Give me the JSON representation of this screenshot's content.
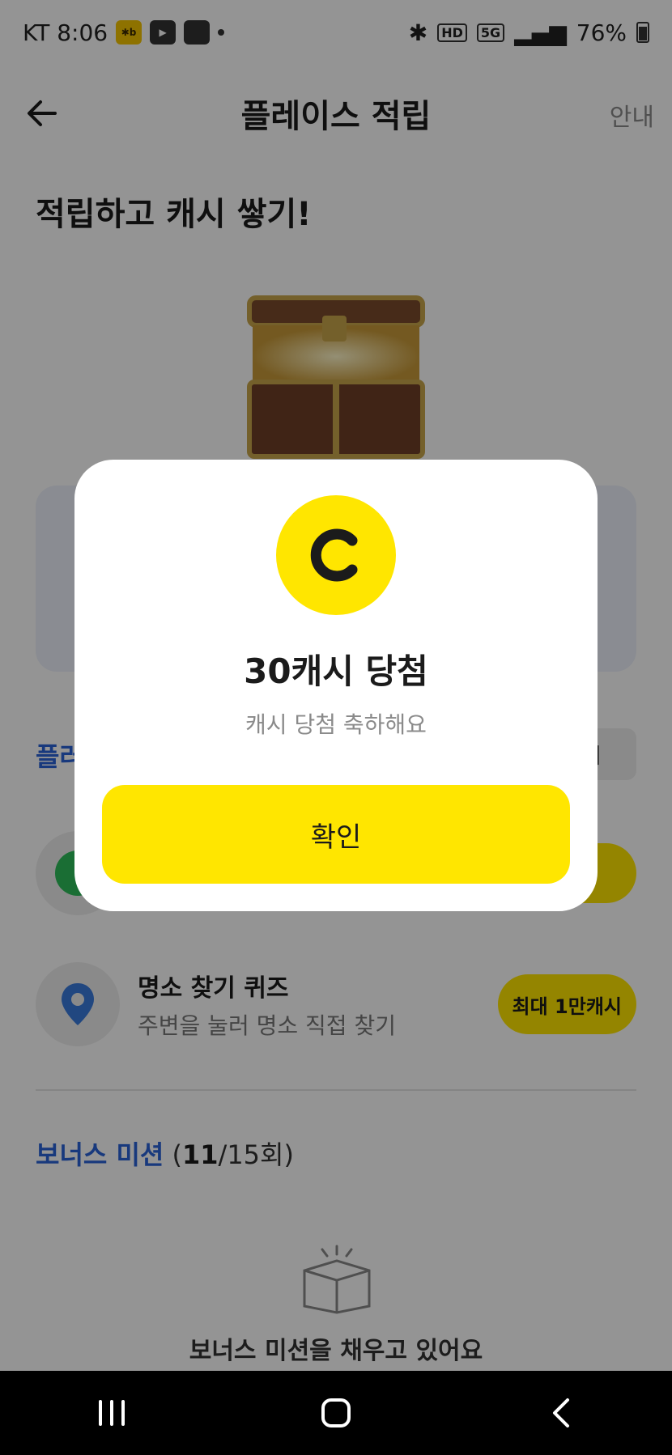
{
  "status_bar": {
    "carrier_time": "KT 8:06",
    "kakao_icon_text": "✱b",
    "battery": "76%",
    "network": "5G",
    "hd": "HD"
  },
  "header": {
    "title": "플레이스 적립",
    "guide_label": "안내"
  },
  "headline": "적립하고 캐시 쌓기!",
  "background": {
    "section_title_partial": "플러",
    "section_right_partial": "기",
    "missions": [
      {
        "title": "명소 찾기 퀴즈",
        "subtitle": "주변을 눌러 명소 직접 찾기",
        "badge": "최대 1만캐시"
      }
    ],
    "bonus": {
      "title": "보너스 미션",
      "open": " (",
      "done": "11",
      "rest": "/15회)"
    },
    "empty_text": "보너스 미션을 채우고 있어요"
  },
  "modal": {
    "coin_letter": "C",
    "title": "30캐시 당첨",
    "subtitle": "캐시 당첨 축하해요",
    "confirm_label": "확인"
  },
  "colors": {
    "accent_yellow": "#ffe600",
    "link_blue": "#2a63d8",
    "dim": "rgba(0,0,0,0.42)"
  },
  "icons": [
    "back-arrow-icon",
    "treasure-chest-icon",
    "location-pin-icon",
    "empty-box-icon",
    "recent-apps-icon",
    "home-icon",
    "nav-back-icon"
  ]
}
